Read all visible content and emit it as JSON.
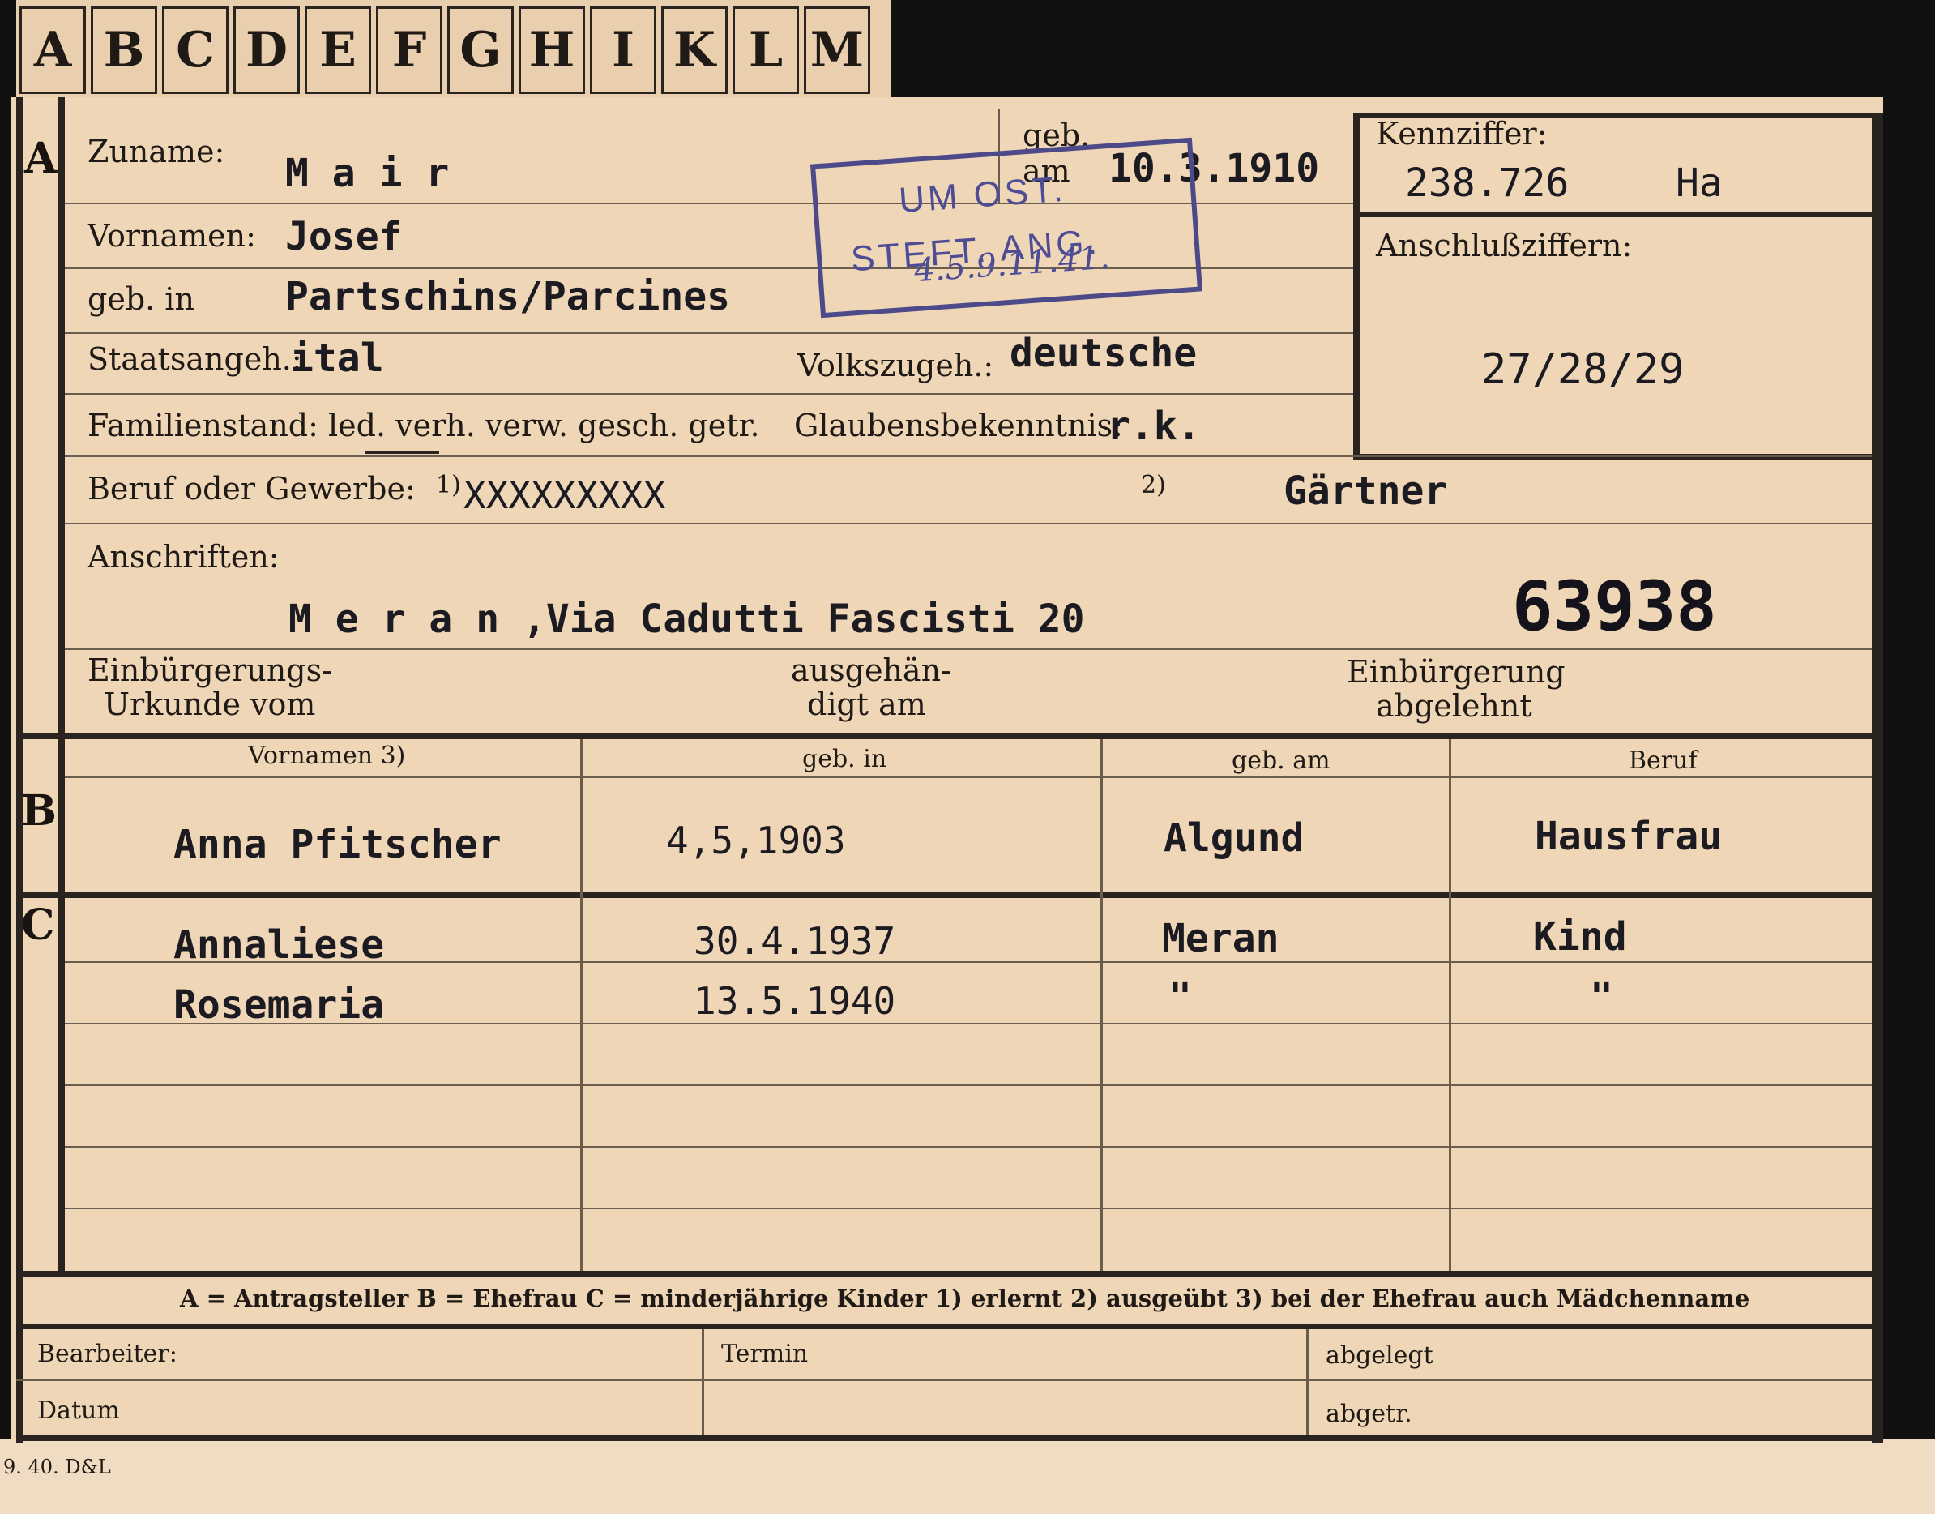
{
  "tabs": [
    "A",
    "B",
    "C",
    "D",
    "E",
    "F",
    "G",
    "H",
    "I",
    "K",
    "L",
    "M"
  ],
  "section_markers": {
    "a": "A",
    "b": "B",
    "c": "C"
  },
  "applicant": {
    "zuname_label": "Zuname:",
    "zuname": "M a i r",
    "geb_label": "geb.",
    "am_label": "am",
    "geb_am": "10.3.1910",
    "vornamen_label": "Vornamen:",
    "vornamen": "Josef",
    "geb_in_label": "geb. in",
    "geb_in": "Partschins/Parcines",
    "staatsangeh_label": "Staatsangeh.:",
    "staatsangeh": "ital",
    "volkszugeh_label": "Volkszugeh.:",
    "volkszugeh": "deutsche",
    "familienstand_label": "Familienstand: led. verh. verw. gesch. getr.",
    "glauben_label": "Glaubensbekenntnis:",
    "glauben": "r.k.",
    "beruf_label": "Beruf oder Gewerbe:",
    "footnote1": "1)",
    "beruf_1": "XXXXXXXXX",
    "footnote2": "2)",
    "beruf_2": "Gärtner",
    "anschriften_label": "Anschriften:",
    "anschrift": "M e r a n ,Via Cadutti Fascisti 20",
    "number": "63938",
    "einb_urkunde_label_1": "Einbürgerungs-",
    "einb_urkunde_label_2": "Urkunde vom",
    "ausgehaen_label_1": "ausgehän-",
    "ausgehaen_label_2": "digt am",
    "einb_abgelehnt_label_1": "Einbürgerung",
    "einb_abgelehnt_label_2": "abgelehnt"
  },
  "right_box": {
    "kennziffer_label": "Kennziffer:",
    "kennziffer": "238.726",
    "kennziffer_suffix": "Ha",
    "anschluss_label": "Anschlußziffern:",
    "anschluss": "27/28/29"
  },
  "stamp": {
    "line1": "UM OST.",
    "line2": "STEFT. ANG.",
    "handwritten": "4.5.9.11.41."
  },
  "columns": {
    "vornamen": "Vornamen 3)",
    "geb_in": "geb. in",
    "geb_am": "geb. am",
    "beruf": "Beruf"
  },
  "wife": {
    "name": "Anna Pfitscher",
    "date": "4,5,1903",
    "place": "Algund",
    "beruf": "Hausfrau"
  },
  "children": [
    {
      "name": "Annaliese",
      "date": "30.4.1937",
      "place": "Meran",
      "beruf": "Kind"
    },
    {
      "name": "Rosemaria",
      "date": "13.5.1940",
      "place": "\"",
      "beruf": "\""
    }
  ],
  "legend": "A = Antragsteller   B = Ehefrau   C = minderjährige Kinder   1) erlernt   2) ausgeübt   3) bei der Ehefrau auch Mädchenname",
  "footer": {
    "bearbeiter": "Bearbeiter:",
    "datum": "Datum",
    "termin": "Termin",
    "abgelegt": "abgelegt",
    "abgetr": "abgetr."
  },
  "print_mark": "9. 40. D&L"
}
